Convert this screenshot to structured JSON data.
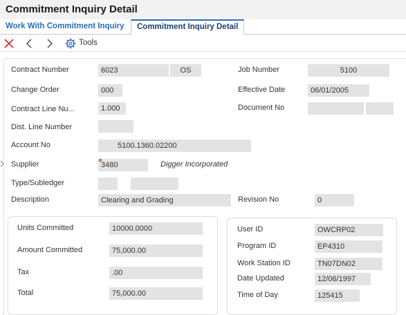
{
  "window": {
    "title": "Commitment Inquiry Detail"
  },
  "tabs": [
    {
      "label": "Work With Commitment Inquiry"
    },
    {
      "label": "Commitment Inquiry Detail"
    }
  ],
  "toolbar": {
    "tools_label": "Tools"
  },
  "form": {
    "contract_number": {
      "label": "Contract Number",
      "value": "6023",
      "type": "OS"
    },
    "job_number": {
      "label": "Job Number",
      "value": "5100"
    },
    "change_order": {
      "label": "Change Order",
      "value": "000"
    },
    "effective_date": {
      "label": "Effective Date",
      "value": "06/01/2005"
    },
    "contract_line_number": {
      "label": "Contract Line Nu...",
      "value": "1.000"
    },
    "document_no": {
      "label": "Document No",
      "value": "",
      "value2": ""
    },
    "dist_line_number": {
      "label": "Dist. Line Number",
      "value": ""
    },
    "account_no": {
      "label": "Account No",
      "value": "5100.1360.02200"
    },
    "supplier": {
      "label": "Supplier",
      "value": "3480",
      "name": "Digger Incorporated"
    },
    "type_subledger": {
      "label": "Type/Subledger",
      "type": "",
      "subledger": ""
    },
    "description": {
      "label": "Description",
      "value": "Clearing and Grading"
    },
    "revision_no": {
      "label": "Revision No",
      "value": "0"
    }
  },
  "amounts": {
    "units_committed": {
      "label": "Units Committed",
      "value": "10000.0000"
    },
    "amount_committed": {
      "label": "Amount Committed",
      "value": "75,000.00"
    },
    "tax": {
      "label": "Tax",
      "value": ".00"
    },
    "total": {
      "label": "Total",
      "value": "75,000.00"
    }
  },
  "audit": {
    "user_id": {
      "label": "User ID",
      "value": "OWCRP02"
    },
    "program_id": {
      "label": "Program ID",
      "value": "EP4310"
    },
    "work_station_id": {
      "label": "Work Station ID",
      "value": "TN07DN02"
    },
    "date_updated": {
      "label": "Date Updated",
      "value": "12/06/1997"
    },
    "time_of_day": {
      "label": "Time of Day",
      "value": "125415"
    }
  },
  "icons": {
    "close": "close-icon",
    "previous": "chevron-left-icon",
    "next": "chevron-right-icon",
    "tools": "gear-icon"
  },
  "colors": {
    "accent": "#2a6ebb",
    "close": "#d9232d",
    "field_bg": "#e3e3e3",
    "flag": "#e8702a"
  }
}
